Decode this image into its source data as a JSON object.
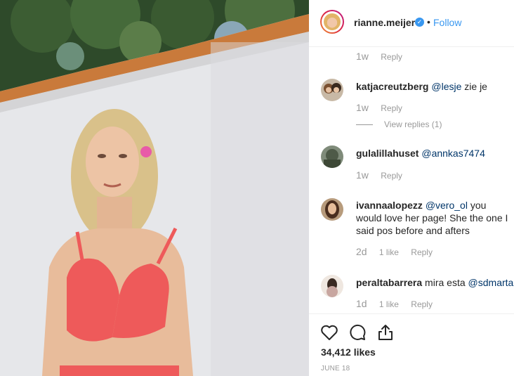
{
  "header": {
    "username": "rianne.meijer",
    "verified_icon": "verified-check-icon",
    "separator": "•",
    "follow_label": "Follow"
  },
  "comments": [
    {
      "time": "1w",
      "reply_label": "Reply"
    },
    {
      "username": "katjacreutzberg",
      "mention": "@lesje",
      "text": " zie je",
      "time": "1w",
      "reply_label": "Reply",
      "view_replies": "View replies (1)"
    },
    {
      "username": "gulalillahuset",
      "mention": "@annkas7474",
      "text": "",
      "time": "1w",
      "reply_label": "Reply"
    },
    {
      "username": "ivannaalopezz",
      "mention": "@vero_ol",
      "text": " you would love her page! She the one I said pos before and afters",
      "time": "2d",
      "likes": "1 like",
      "reply_label": "Reply"
    },
    {
      "username": "peraltabarrera",
      "text": " mira esta ",
      "mention": "@sdmarta",
      "time": "1d",
      "likes": "1 like",
      "reply_label": "Reply"
    }
  ],
  "actions": {
    "like_icon": "heart-icon",
    "comment_icon": "comment-icon",
    "share_icon": "share-icon",
    "likes_count": "34,412 likes",
    "date": "JUNE 18"
  }
}
